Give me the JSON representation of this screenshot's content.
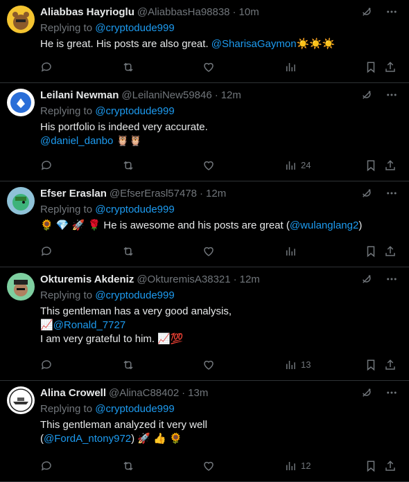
{
  "replying_prefix": "Replying to",
  "colors": {
    "accent": "#1d9bf0",
    "muted": "#71767b",
    "border": "#2f3336",
    "background": "#000000"
  },
  "tweets": [
    {
      "name": "Aliabbas Hayrioglu",
      "handle": "@AliabbasHa98838",
      "dot": "·",
      "time": "10m",
      "replying_to": "@cryptodude999",
      "lines": [
        {
          "text": "He is great. His posts are also great. ",
          "mention": "@SharisaGaymon",
          "after": "☀️☀️☀️"
        }
      ],
      "views": "",
      "avatar": "bear-avatar"
    },
    {
      "name": "Leilani Newman",
      "handle": "@LeilaniNew59846",
      "dot": "·",
      "time": "12m",
      "replying_to": "@cryptodude999",
      "lines": [
        {
          "text": "His portfolio is indeed very accurate.",
          "mention": "",
          "after": ""
        },
        {
          "text": "",
          "mention": "@daniel_danbo",
          "after": " 🦉🦉"
        }
      ],
      "views": "24",
      "avatar": "blue-logo-avatar"
    },
    {
      "name": "Efser Eraslan",
      "handle": "@EfserErasl57478",
      "dot": "·",
      "time": "12m",
      "replying_to": "@cryptodude999",
      "lines": [
        {
          "text": "🌻 💎 🚀 🌹 He is awesome and his posts are great (",
          "mention": "@wulanglang2",
          "after": ")"
        }
      ],
      "views": "",
      "avatar": "green-character-avatar"
    },
    {
      "name": "Okturemis Akdeniz",
      "handle": "@OkturemisA38321",
      "dot": "·",
      "time": "12m",
      "replying_to": "@cryptodude999",
      "lines": [
        {
          "text": "This gentleman has a very good analysis,",
          "mention": "",
          "after": ""
        },
        {
          "text": "📈",
          "mention": "@Ronald_7727",
          "after": ""
        },
        {
          "text": "I am very grateful to him. 📈💯",
          "mention": "",
          "after": ""
        }
      ],
      "views": "13",
      "avatar": "hat-character-avatar"
    },
    {
      "name": "Alina Crowell",
      "handle": "@AlinaC88402",
      "dot": "·",
      "time": "13m",
      "replying_to": "@cryptodude999",
      "lines": [
        {
          "text": "This gentleman analyzed it very well",
          "mention": "",
          "after": ""
        },
        {
          "text": "(",
          "mention": "@FordA_ntony972",
          "after": ") 🚀 👍 🌻"
        }
      ],
      "views": "12",
      "avatar": "ship-logo-avatar"
    }
  ]
}
